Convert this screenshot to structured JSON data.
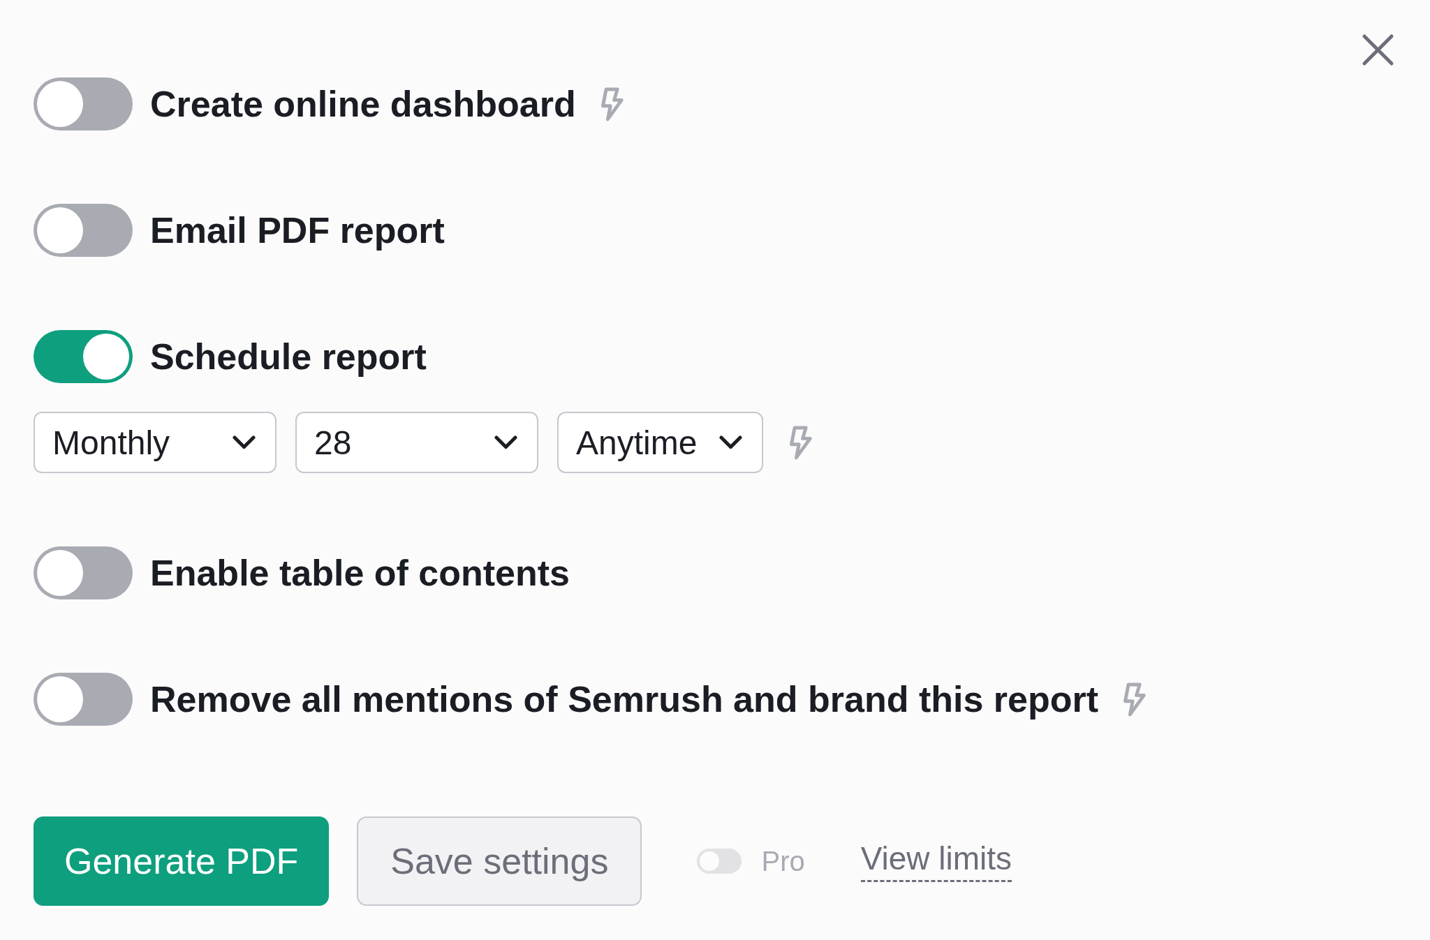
{
  "options": [
    {
      "label": "Create online dashboard",
      "on": false,
      "bolt": true
    },
    {
      "label": "Email PDF report",
      "on": false,
      "bolt": false
    },
    {
      "label": "Schedule report",
      "on": true,
      "bolt": false,
      "schedule": {
        "fields": [
          {
            "value": "Monthly"
          },
          {
            "value": "28"
          },
          {
            "value": "Anytime"
          }
        ],
        "bolt": true
      }
    },
    {
      "label": "Enable table of contents",
      "on": false,
      "bolt": false
    },
    {
      "label": "Remove all mentions of Semrush and brand this report",
      "on": false,
      "bolt": true
    }
  ],
  "footer": {
    "primary_button": "Generate PDF",
    "secondary_button": "Save settings",
    "pro_toggle": {
      "label": "Pro",
      "on": false,
      "disabled": true
    },
    "link": "View limits"
  }
}
